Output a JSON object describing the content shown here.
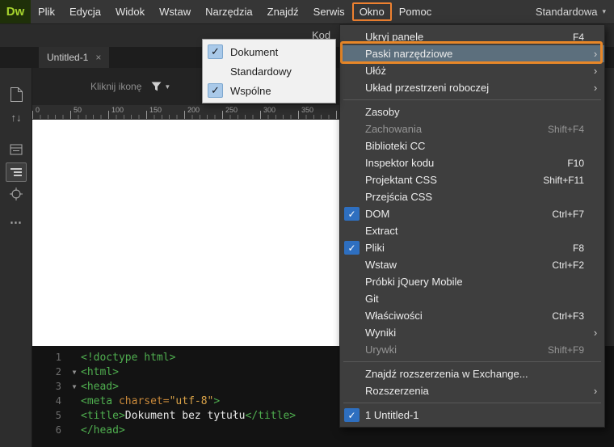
{
  "menubar": {
    "logo_text": "Dw",
    "items": [
      {
        "label": "Plik"
      },
      {
        "label": "Edycja"
      },
      {
        "label": "Widok"
      },
      {
        "label": "Wstaw"
      },
      {
        "label": "Narzędzia"
      },
      {
        "label": "Znajdź"
      },
      {
        "label": "Serwis"
      },
      {
        "label": "Okno",
        "annotated": true
      },
      {
        "label": "Pomoc"
      }
    ],
    "workspace": "Standardowa"
  },
  "document_toolbar": {
    "code_view_label": "Kod"
  },
  "tab": {
    "title": "Untitled-1",
    "close_glyph": "×"
  },
  "common_toolbar": {
    "hint": "Kliknij ikonę"
  },
  "ruler": {
    "ticks": [
      "0",
      "50",
      "100",
      "150",
      "200",
      "250",
      "300",
      "350"
    ]
  },
  "window_menu": {
    "items": [
      {
        "label": "Ukryj panele",
        "shortcut": "F4"
      },
      {
        "label": "Paski narzędziowe",
        "submenu": true,
        "highlighted": true,
        "annotated": true
      },
      {
        "label": "Ułóż",
        "submenu": true
      },
      {
        "label": "Układ przestrzeni roboczej",
        "submenu": true
      },
      {
        "separator": true
      },
      {
        "label": "Zasoby"
      },
      {
        "label": "Zachowania",
        "shortcut": "Shift+F4",
        "disabled": true
      },
      {
        "label": "Biblioteki CC"
      },
      {
        "label": "Inspektor kodu",
        "shortcut": "F10"
      },
      {
        "label": "Projektant CSS",
        "shortcut": "Shift+F11"
      },
      {
        "label": "Przejścia CSS"
      },
      {
        "label": "DOM",
        "shortcut": "Ctrl+F7",
        "checked": true
      },
      {
        "label": "Extract"
      },
      {
        "label": "Pliki",
        "shortcut": "F8",
        "checked": true
      },
      {
        "label": "Wstaw",
        "shortcut": "Ctrl+F2"
      },
      {
        "label": "Próbki jQuery Mobile"
      },
      {
        "label": "Git"
      },
      {
        "label": "Właściwości",
        "shortcut": "Ctrl+F3"
      },
      {
        "label": "Wyniki",
        "submenu": true
      },
      {
        "label": "Urywki",
        "shortcut": "Shift+F9",
        "disabled": true
      },
      {
        "separator": true
      },
      {
        "label": "Znajdź rozszerzenia w Exchange..."
      },
      {
        "label": "Rozszerzenia",
        "submenu": true
      },
      {
        "separator": true
      },
      {
        "label": "1 Untitled-1",
        "checked": true
      }
    ]
  },
  "toolbars_submenu": {
    "items": [
      {
        "label": "Dokument",
        "checked": true
      },
      {
        "label": "Standardowy",
        "checked": false
      },
      {
        "label": "Wspólne",
        "checked": true
      }
    ]
  },
  "code": {
    "lines": [
      {
        "num": "1",
        "fold": false,
        "tokens": [
          {
            "c": "tag",
            "t": "<!doctype html>"
          }
        ]
      },
      {
        "num": "2",
        "fold": true,
        "tokens": [
          {
            "c": "tag",
            "t": "<html>"
          }
        ]
      },
      {
        "num": "3",
        "fold": true,
        "tokens": [
          {
            "c": "tag",
            "t": "<head>"
          }
        ]
      },
      {
        "num": "4",
        "fold": false,
        "tokens": [
          {
            "c": "tag",
            "t": "<meta "
          },
          {
            "c": "attr",
            "t": "charset="
          },
          {
            "c": "str",
            "t": "\"utf-8\""
          },
          {
            "c": "tag",
            "t": ">"
          }
        ]
      },
      {
        "num": "5",
        "fold": false,
        "tokens": [
          {
            "c": "tag",
            "t": "<title>"
          },
          {
            "c": "plain",
            "t": "Dokument bez tytułu"
          },
          {
            "c": "tag",
            "t": "</title>"
          }
        ]
      },
      {
        "num": "6",
        "fold": false,
        "tokens": [
          {
            "c": "tag",
            "t": "</head>"
          }
        ]
      }
    ]
  },
  "colors": {
    "annotation_orange": "#e88728",
    "check_blue": "#2e6fc0",
    "tag_green": "#4fae4f",
    "attr_orange": "#c9893a",
    "string_orange": "#dba348",
    "logo_green": "#a7d42e",
    "menu_bg": "#3e3e3e",
    "submenu_bg": "#f1f1f1"
  }
}
